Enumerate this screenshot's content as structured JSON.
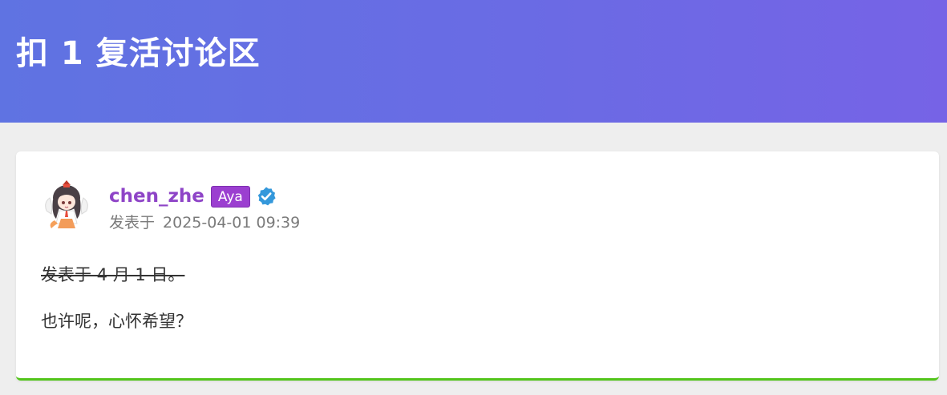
{
  "header": {
    "title": "扣 1 复活讨论区"
  },
  "post": {
    "author": {
      "username": "chen_zhe",
      "tag": "Aya",
      "verified_icon": "verified-badge-icon",
      "avatar": "anime-character-avatar"
    },
    "meta": {
      "posted_label": "发表于",
      "timestamp": "2025-04-01 09:39"
    },
    "body": {
      "struck_line": "发表于 4 月 1 日。",
      "line2": "也许呢，心怀希望？"
    }
  },
  "colors": {
    "header_gradient_start": "#5f73e2",
    "header_gradient_end": "#7663e6",
    "username": "#8e44c7",
    "tag_bg": "#9b3fd0",
    "verified": "#3498db",
    "card_accent": "#52c41a"
  }
}
